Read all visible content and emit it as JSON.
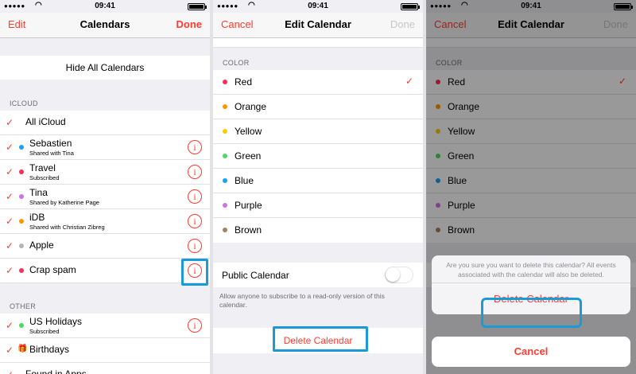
{
  "status": {
    "time": "09:41",
    "signal": "●●●●●"
  },
  "screen1": {
    "nav": {
      "left": "Edit",
      "title": "Calendars",
      "right": "Done"
    },
    "hide_all": "Hide All Calendars",
    "section_icloud": "ICLOUD",
    "icloud_rows": [
      {
        "name": "All iCloud",
        "sub": "",
        "dot": "",
        "info": false
      },
      {
        "name": "Sebastien",
        "sub": "Shared with Tina",
        "dot": "#1ea0f0",
        "info": true
      },
      {
        "name": "Travel",
        "sub": "Subscribed",
        "dot": "#ff2d55",
        "info": true
      },
      {
        "name": "Tina",
        "sub": "Shared by Katherine Page",
        "dot": "#cc73e1",
        "info": true
      },
      {
        "name": "iDB",
        "sub": "Shared with Christian Zibreg",
        "dot": "#ff9500",
        "info": true
      },
      {
        "name": "Apple",
        "sub": "",
        "dot": "#b4b4b4",
        "info": true
      },
      {
        "name": "Crap spam",
        "sub": "",
        "dot": "#ff2d55",
        "info": true
      }
    ],
    "section_other": "OTHER",
    "other_rows": [
      {
        "name": "US Holidays",
        "sub": "Subscribed",
        "dot": "#4cd964",
        "info": true
      },
      {
        "name": "Birthdays",
        "sub": "",
        "dot": "",
        "info": false
      },
      {
        "name": "Found in Apps",
        "sub": "",
        "dot": "",
        "info": false
      }
    ],
    "info_glyph": "i"
  },
  "screen2": {
    "nav": {
      "left": "Cancel",
      "title": "Edit Calendar",
      "right": "Done"
    },
    "section_color": "COLOR",
    "colors": [
      {
        "name": "Red",
        "hex": "#ff2d55",
        "selected": true
      },
      {
        "name": "Orange",
        "hex": "#ff9500",
        "selected": false
      },
      {
        "name": "Yellow",
        "hex": "#ffcc00",
        "selected": false
      },
      {
        "name": "Green",
        "hex": "#4cd964",
        "selected": false
      },
      {
        "name": "Blue",
        "hex": "#1ea0f0",
        "selected": false
      },
      {
        "name": "Purple",
        "hex": "#cc73e1",
        "selected": false
      },
      {
        "name": "Brown",
        "hex": "#a2845e",
        "selected": false
      }
    ],
    "public_label": "Public Calendar",
    "public_on": false,
    "public_note": "Allow anyone to subscribe to a read-only version of this calendar.",
    "delete_label": "Delete Calendar"
  },
  "screen3": {
    "nav": {
      "left": "Cancel",
      "title": "Edit Calendar",
      "right": "Done"
    },
    "section_color": "COLOR",
    "alert_message": "Are you sure you want to delete this calendar? All events associated with the calendar will also be deleted.",
    "delete_label": "Delete Calendar",
    "cancel_label": "Cancel"
  },
  "glyphs": {
    "check": "✓",
    "gift": "🎁",
    "wifi": "◠"
  },
  "colors": {
    "accent": "#ff3b30",
    "highlight": "#1a9ad6",
    "background": "#efeff4"
  }
}
